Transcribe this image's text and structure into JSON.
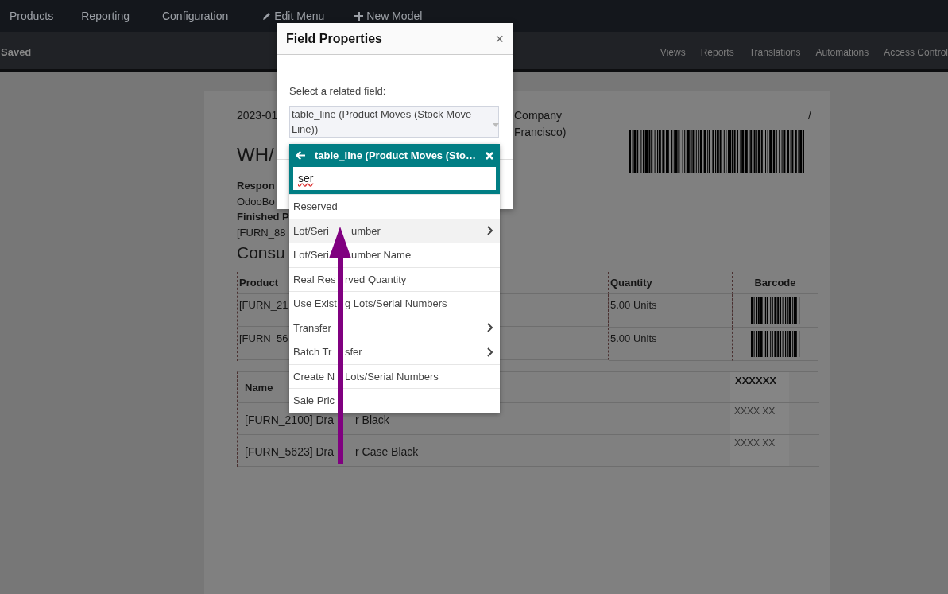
{
  "navbar": {
    "items": [
      {
        "label": "Products"
      },
      {
        "label": "Reporting"
      },
      {
        "label": "Configuration"
      }
    ],
    "tools": [
      {
        "kind": "edit",
        "label": "Edit Menu"
      },
      {
        "kind": "add",
        "label": "New Model"
      }
    ]
  },
  "toolbar": {
    "status": "Saved",
    "links": [
      "Views",
      "Reports",
      "Translations",
      "Automations",
      "Access Control"
    ]
  },
  "report": {
    "date": "2023-01",
    "company": "Company",
    "slash": "/",
    "city": "Francisco)",
    "reference": "WH/",
    "fields": [
      {
        "kind": "label",
        "text": "Respon"
      },
      {
        "kind": "value",
        "text": "OdooBo"
      },
      {
        "kind": "label",
        "text": "Finished P"
      },
      {
        "kind": "value",
        "text": "[FURN_88"
      }
    ],
    "section_title": "Consu",
    "moves_table": {
      "columns": [
        "Product",
        "Quantity",
        "Barcode"
      ],
      "rows": [
        {
          "product": "[FURN_21",
          "quantity": "5.00 Units"
        },
        {
          "product": "[FURN_56",
          "quantity": "5.00 Units"
        }
      ]
    },
    "lots_table": {
      "columns": [
        "Name",
        "XXXXXX"
      ],
      "rows": [
        {
          "name": "[FURN_2100] Dra",
          "name_tail": "r Black",
          "code": "XXXX XX"
        },
        {
          "name": "[FURN_5623] Dra",
          "name_tail": "r Case Black",
          "code": "XXXX XX"
        }
      ]
    }
  },
  "dialog": {
    "title": "Field Properties",
    "close": "×",
    "field_label": "Select a related field:",
    "field_value": "table_line (Product Moves (Stock Move Line))",
    "popover": {
      "title": "table_line (Product Moves (Sto…",
      "search": "ser",
      "items": [
        {
          "label": "Reserved",
          "has_children": false,
          "selected": false
        },
        {
          "label": "Lot/Seri",
          "label_tail": "umber",
          "has_children": true,
          "selected": true
        },
        {
          "label": "Lot/Seri",
          "label_tail": "umber Name",
          "has_children": false,
          "selected": false
        },
        {
          "label": "Real Res",
          "label_tail": "rved Quantity",
          "has_children": false,
          "selected": false
        },
        {
          "label": "Use Exist",
          "label_tail": "g Lots/Serial Numbers",
          "has_children": false,
          "selected": false
        },
        {
          "label": "Transfer",
          "has_children": true,
          "selected": false
        },
        {
          "label": "Batch Tr",
          "label_tail": "sfer",
          "has_children": true,
          "selected": false
        },
        {
          "label": "Create N",
          "label_tail": "Lots/Serial Numbers",
          "has_children": false,
          "selected": false
        },
        {
          "label": "Sale Pric",
          "has_children": false,
          "selected": false
        }
      ]
    }
  }
}
